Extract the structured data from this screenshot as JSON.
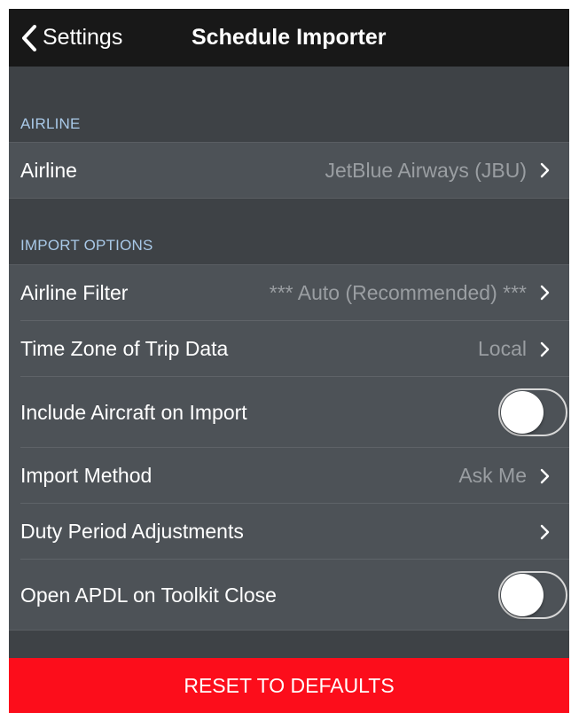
{
  "navbar": {
    "back_label": "Settings",
    "title": "Schedule Importer"
  },
  "sections": {
    "airline": {
      "header": "AIRLINE",
      "rows": [
        {
          "label": "Airline",
          "value": "JetBlue Airways (JBU)"
        }
      ]
    },
    "import_options": {
      "header": "IMPORT OPTIONS",
      "rows": [
        {
          "label": "Airline Filter",
          "value": "*** Auto (Recommended) ***"
        },
        {
          "label": "Time Zone of Trip Data",
          "value": "Local"
        },
        {
          "label": "Include Aircraft on Import",
          "toggle_on": false
        },
        {
          "label": "Import Method",
          "value": "Ask Me"
        },
        {
          "label": "Duty Period Adjustments",
          "value": ""
        },
        {
          "label": "Open APDL on Toolkit Close",
          "toggle_on": false
        }
      ]
    }
  },
  "reset_button": {
    "label": "RESET TO DEFAULTS"
  },
  "colors": {
    "background": "#3e4246",
    "row": "#4d5257",
    "navbar": "#181818",
    "section_header": "#a9c9e8",
    "value_text": "#9a9ea2",
    "reset": "#fc0d1b"
  },
  "icons": {
    "back": "chevron-left-icon",
    "disclosure": "chevron-right-icon"
  }
}
